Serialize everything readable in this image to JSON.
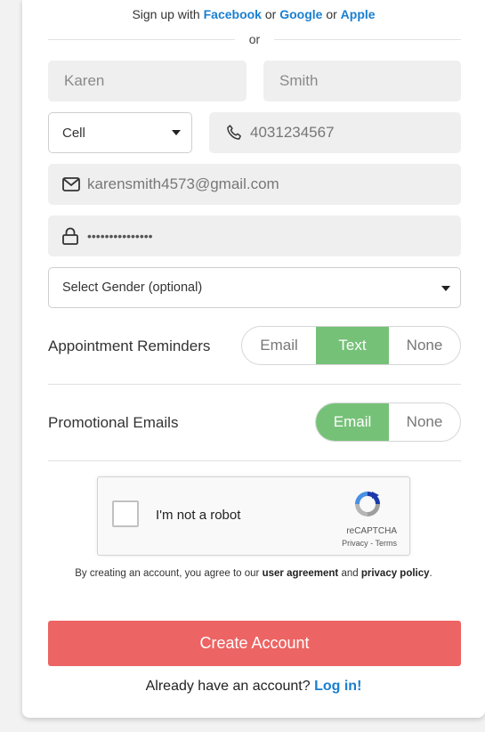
{
  "social": {
    "prefix": "Sign up with",
    "facebook": "Facebook",
    "sep1": "or",
    "google": "Google",
    "sep2": "or",
    "apple": "Apple"
  },
  "divider_or": "or",
  "form": {
    "first_name": "Karen",
    "last_name": "Smith",
    "phone_type": "Cell",
    "phone": "4031234567",
    "email": "karensmith4573@gmail.com",
    "password": "•••••••••••••••",
    "gender": "Select Gender (optional)"
  },
  "reminders": {
    "label": "Appointment Reminders",
    "options": [
      "Email",
      "Text",
      "None"
    ],
    "selected": "Text"
  },
  "promos": {
    "label": "Promotional Emails",
    "options": [
      "Email",
      "None"
    ],
    "selected": "Email"
  },
  "captcha": {
    "label": "I'm not a robot",
    "brand": "reCAPTCHA",
    "links": "Privacy - Terms"
  },
  "terms": {
    "prefix": "By creating an account, you agree to our",
    "agreement": "user agreement",
    "and": "and",
    "privacy": "privacy policy",
    "suffix": "."
  },
  "create_button": "Create Account",
  "login": {
    "prefix": "Already have an account?",
    "link": "Log in!"
  },
  "colors": {
    "accent_blue": "#1a7fd0",
    "toggle_green": "#76c178",
    "create_red": "#ec6463"
  }
}
